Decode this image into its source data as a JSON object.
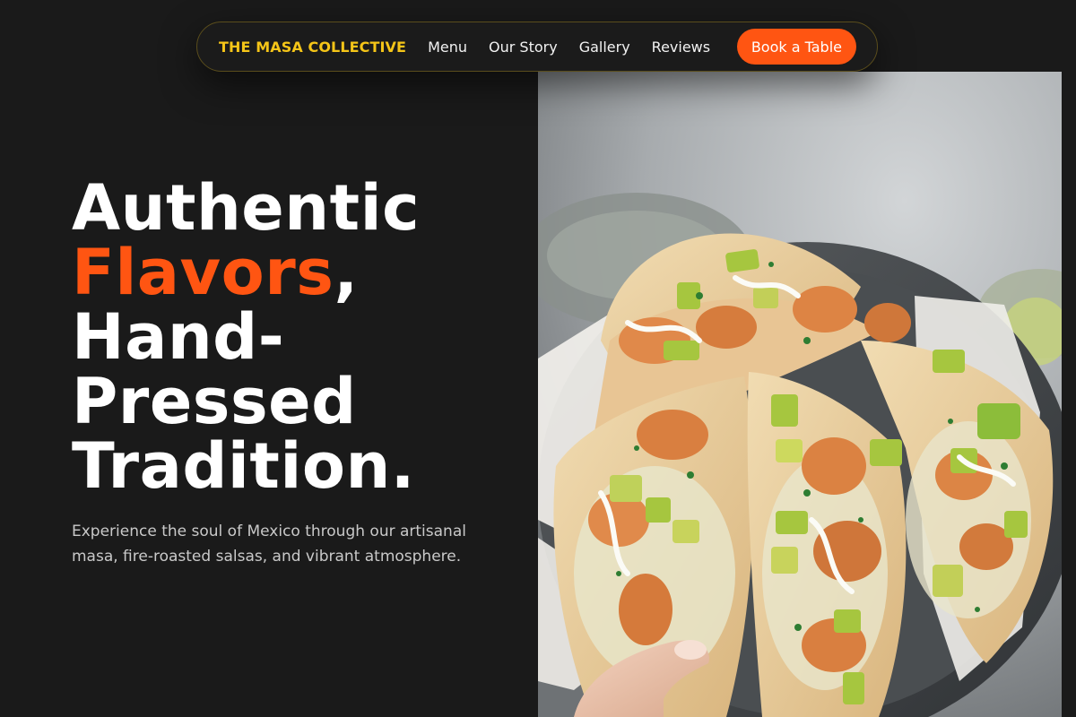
{
  "nav": {
    "brand": "THE MASA COLLECTIVE",
    "links": [
      "Menu",
      "Our Story",
      "Gallery",
      "Reviews"
    ],
    "cta": "Book a Table"
  },
  "hero": {
    "line1": "Authentic",
    "line2_accent": "Flavors",
    "line2_rest": ",",
    "line3": "Hand-",
    "line4": "Pressed",
    "line5": "Tradition.",
    "subtitle": "Experience the soul of Mexico through our artisanal masa, fire-roasted salsas, and vibrant atmosphere."
  },
  "colors": {
    "background": "#1a1a1a",
    "brand": "#f5c518",
    "accent": "#ff5512",
    "text": "#ffffff",
    "muted": "#c9c9c9"
  },
  "image": {
    "subject": "shrimp tacos with avocado salsa on a plate held by a hand"
  }
}
